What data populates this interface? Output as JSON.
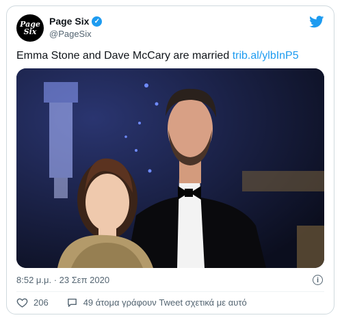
{
  "author": {
    "name": "Page Six",
    "handle": "@PageSix",
    "avatar_line1": "Page",
    "avatar_line2": "Six"
  },
  "tweet": {
    "text": "Emma Stone and Dave McCary are married",
    "link": "trib.al/ylbInP5",
    "timestamp": "8:52 μ.μ. · 23 Σεπ 2020"
  },
  "engagement": {
    "likes": "206",
    "replies_text": "49 άτομα γράφουν Tweet σχετικά με αυτό"
  },
  "icons": {
    "verified": "verified-badge-icon",
    "logo": "twitter-bird-icon",
    "info": "info-icon",
    "like": "heart-icon",
    "reply": "speech-bubble-icon"
  },
  "colors": {
    "accent": "#1d9bf0",
    "secondary_text": "#536471"
  }
}
